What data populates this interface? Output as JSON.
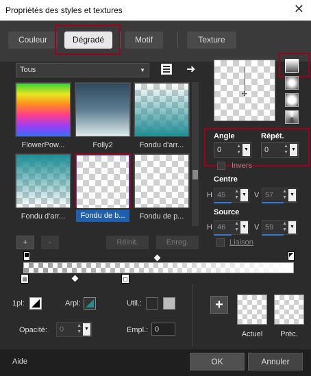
{
  "window": {
    "title": "Propriétés des styles et textures",
    "close": "✕"
  },
  "tabs": [
    {
      "label": "Couleur",
      "active": false
    },
    {
      "label": "Dégradé",
      "active": true
    },
    {
      "label": "Motif",
      "active": false
    },
    {
      "label": "Texture",
      "active": false
    }
  ],
  "category": {
    "value": "Tous"
  },
  "gradients": [
    {
      "label": "FlowerPow..."
    },
    {
      "label": "Folly2"
    },
    {
      "label": "Fondu d'arr..."
    },
    {
      "label": "Fondu d'arr..."
    },
    {
      "label": "Fondu de b...",
      "selected": true
    },
    {
      "label": "Fondu de p..."
    }
  ],
  "list_buttons": {
    "add": "+",
    "remove": "-",
    "reset": "Réinit.",
    "save": "Enreg."
  },
  "angle": {
    "label": "Angle",
    "value": "0"
  },
  "repeat": {
    "label": "Répét.",
    "value": "0"
  },
  "invert": {
    "label": "Invers"
  },
  "center": {
    "label": "Centre",
    "h_label": "H",
    "h": "45",
    "v_label": "V",
    "v": "57"
  },
  "source": {
    "label": "Source",
    "h_label": "H",
    "h": "46",
    "v_label": "V",
    "v": "59"
  },
  "link": {
    "label": "Liaison"
  },
  "bottom": {
    "pl_label": "1pl:",
    "arpl_label": "Arpl:",
    "util_label": "Util.:",
    "opacity_label": "Opacité:",
    "opacity_value": "0",
    "empl_label": "Empl.:",
    "empl_value": "0",
    "add": "+",
    "current_label": "Actuel",
    "previous_label": "Préc."
  },
  "footer": {
    "help": "Aide",
    "ok": "OK",
    "cancel": "Annuler"
  },
  "colors": {
    "accent": "#2d7be0",
    "highlight": "#a0001a",
    "teal": "#1f8e95"
  }
}
